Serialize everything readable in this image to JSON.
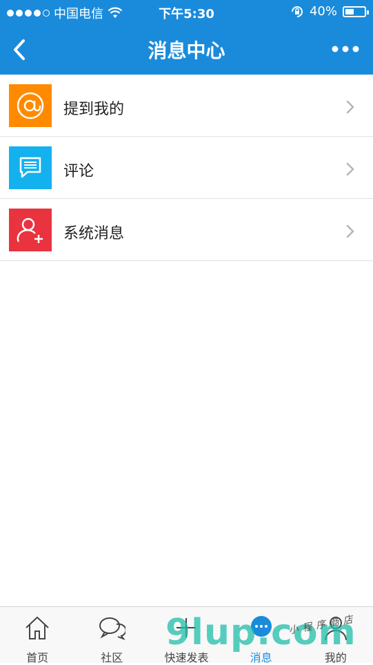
{
  "status_bar": {
    "carrier": "中国电信",
    "time": "下午5:30",
    "battery": "40%"
  },
  "navbar": {
    "title": "消息中心"
  },
  "items": [
    {
      "label": "提到我的",
      "icon": "at-icon",
      "color": "#ff8a00"
    },
    {
      "label": "评论",
      "icon": "comment-icon",
      "color": "#14b1ef"
    },
    {
      "label": "系统消息",
      "icon": "add-user-icon",
      "color": "#e9333e"
    }
  ],
  "tabs": [
    {
      "label": "首页",
      "icon": "home-icon"
    },
    {
      "label": "社区",
      "icon": "chat-bubbles-icon"
    },
    {
      "label": "快速发表",
      "icon": "plus-icon"
    },
    {
      "label": "消息",
      "icon": "message-icon",
      "active": true
    },
    {
      "label": "我的",
      "icon": "user-icon"
    }
  ],
  "watermark": {
    "text": "9lup.com",
    "subtext": "小程序商店"
  }
}
